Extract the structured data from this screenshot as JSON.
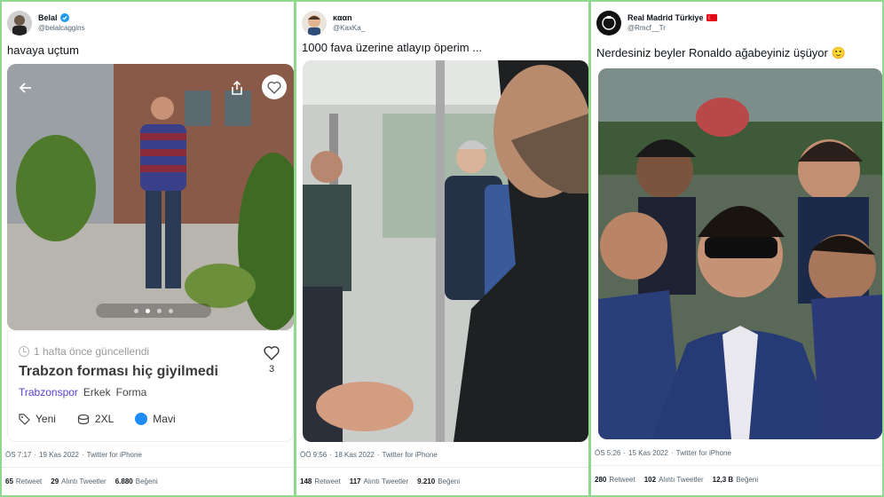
{
  "tweets": [
    {
      "name": "Belal",
      "handle": "@belalcaggins",
      "text": "havaya uçtum",
      "listing": {
        "updated": "1 hafta önce güncellendi",
        "title": "Trabzon forması hiç giyilmedi",
        "brand": "Trabzonspor",
        "tag2": "Erkek",
        "tag3": "Forma",
        "likes": "3",
        "condition": "Yeni",
        "size": "2XL",
        "color": "Mavi",
        "color_hex": "#1d8cf8"
      },
      "time": "ÖS 7:17",
      "date": "19 Kas 2022",
      "source": "Twitter for iPhone",
      "retweets": "65",
      "retweets_label": "Retweet",
      "quotes": "29",
      "quotes_label": "Alıntı Tweetler",
      "likes": "6.880",
      "likes_label": "Beğeni"
    },
    {
      "name": "ĸααn",
      "handle": "@KaxKa_",
      "text": "1000 fava üzerine atlayıp öperim ...",
      "time": "ÖÖ 9:56",
      "date": "18 Kas 2022",
      "source": "Twitter for iPhone",
      "retweets": "148",
      "retweets_label": "Retweet",
      "quotes": "117",
      "quotes_label": "Alıntı Tweetler",
      "likes": "9.210",
      "likes_label": "Beğeni"
    },
    {
      "name": "Real Madrid Türkiye",
      "handle": "@Rmcf__Tr",
      "text": "Nerdesiniz beyler Ronaldo ağabeyiniz üşüyor 🙂",
      "time": "ÖS 5:26",
      "date": "15 Kas 2022",
      "source": "Twitter for iPhone",
      "retweets": "280",
      "retweets_label": "Retweet",
      "quotes": "102",
      "quotes_label": "Alıntı Tweetler",
      "likes": "12,3 B",
      "likes_label": "Beğeni"
    }
  ],
  "separator": "·",
  "colors": {
    "background": "#8fd98f",
    "verified": "#1d9bf0",
    "brand_link": "#5a3fd0"
  }
}
